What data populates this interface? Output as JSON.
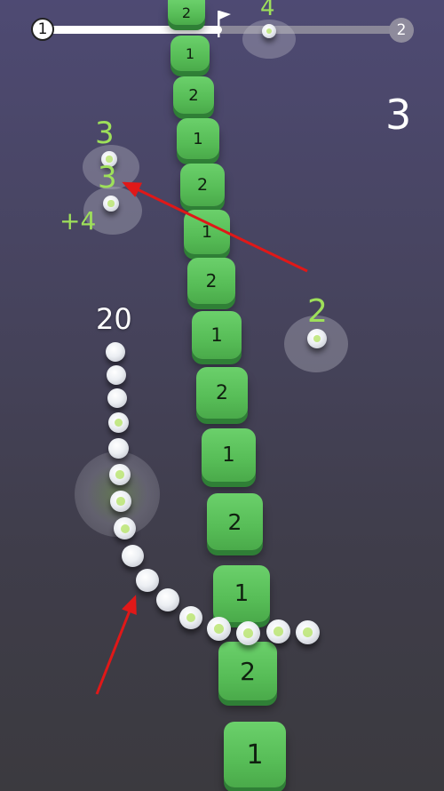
{
  "progress": {
    "current_level": "1",
    "next_level": "2",
    "fraction": 0.5
  },
  "score": "3",
  "snake": {
    "length_label": "20"
  },
  "pickups": [
    {
      "label": "4",
      "color": "#9ee05a"
    },
    {
      "label": "3",
      "color": "#9ee05a"
    },
    {
      "label": "3",
      "color": "#9ee05a"
    },
    {
      "label": "2",
      "color": "#9ee05a"
    }
  ],
  "floating_text": "+4",
  "blocks": [
    "2",
    "1",
    "2",
    "1",
    "2",
    "1",
    "2",
    "1",
    "2",
    "1",
    "2",
    "1",
    "2",
    "1"
  ],
  "colors": {
    "block_green": "#5cc45c",
    "pickup_green": "#9ee05a",
    "arrow_red": "#e01818"
  }
}
